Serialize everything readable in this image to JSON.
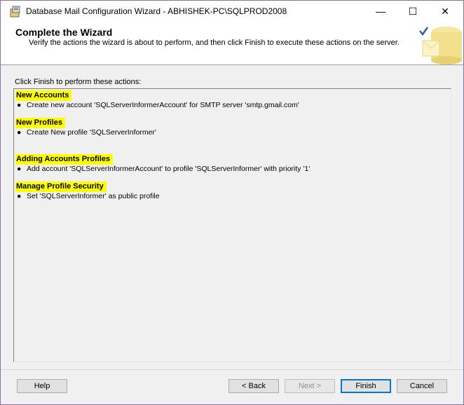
{
  "window": {
    "title": "Database Mail Configuration Wizard - ABHISHEK-PC\\SQLPROD2008",
    "controls": {
      "minimize": "—",
      "maximize": "☐",
      "close": "✕"
    }
  },
  "banner": {
    "title": "Complete the Wizard",
    "subtitle": "Verify the actions the wizard is about to perform, and then click Finish to execute these actions on the server."
  },
  "intro": "Click Finish to perform these actions:",
  "sections": [
    {
      "heading": "New Accounts",
      "items": [
        "Create new account 'SQLServerInformerAccount' for SMTP server 'smtp.gmail.com'"
      ]
    },
    {
      "heading": "New Profiles",
      "items": [
        "Create New profile 'SQLServerInformer'"
      ]
    },
    {
      "heading": "Adding Accounts Profiles",
      "items": [
        "Add account 'SQLServerInformerAccount' to profile 'SQLServerInformer' with priority '1'"
      ]
    },
    {
      "heading": "Manage Profile Security",
      "items": [
        "Set 'SQLServerInformer' as public profile"
      ]
    }
  ],
  "buttons": {
    "help": "Help",
    "back": "< Back",
    "next": "Next >",
    "finish": "Finish",
    "cancel": "Cancel"
  },
  "colors": {
    "highlight": "#ffff00",
    "accent": "#0078d7"
  }
}
